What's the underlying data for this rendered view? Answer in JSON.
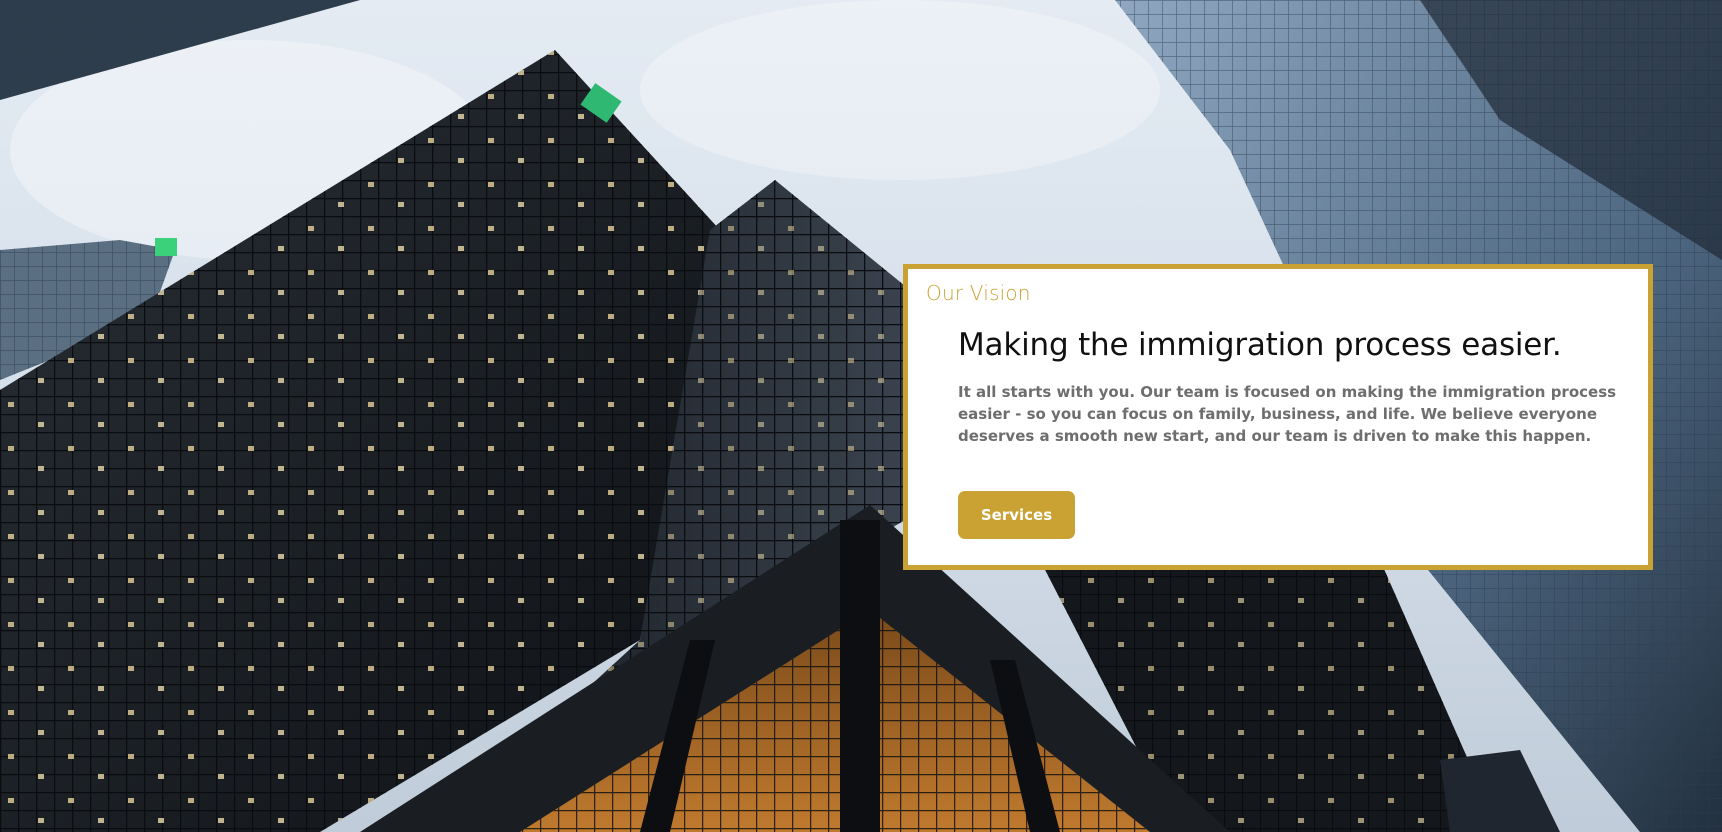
{
  "vision": {
    "eyebrow": "Our Vision",
    "heading": "Making the immigration process easier.",
    "body": "It all starts with you. Our team is focused on making the immigration process easier - so you can focus on family, business, and life. We believe everyone deserves a smooth new start, and our team is driven to make this happen.",
    "button_label": "Services"
  },
  "colors": {
    "accent": "#c9a233",
    "card_background": "#ffffff",
    "heading": "#111111",
    "body_text": "#6e6e6e"
  },
  "background": {
    "icon": "city-skyscrapers-photo"
  }
}
